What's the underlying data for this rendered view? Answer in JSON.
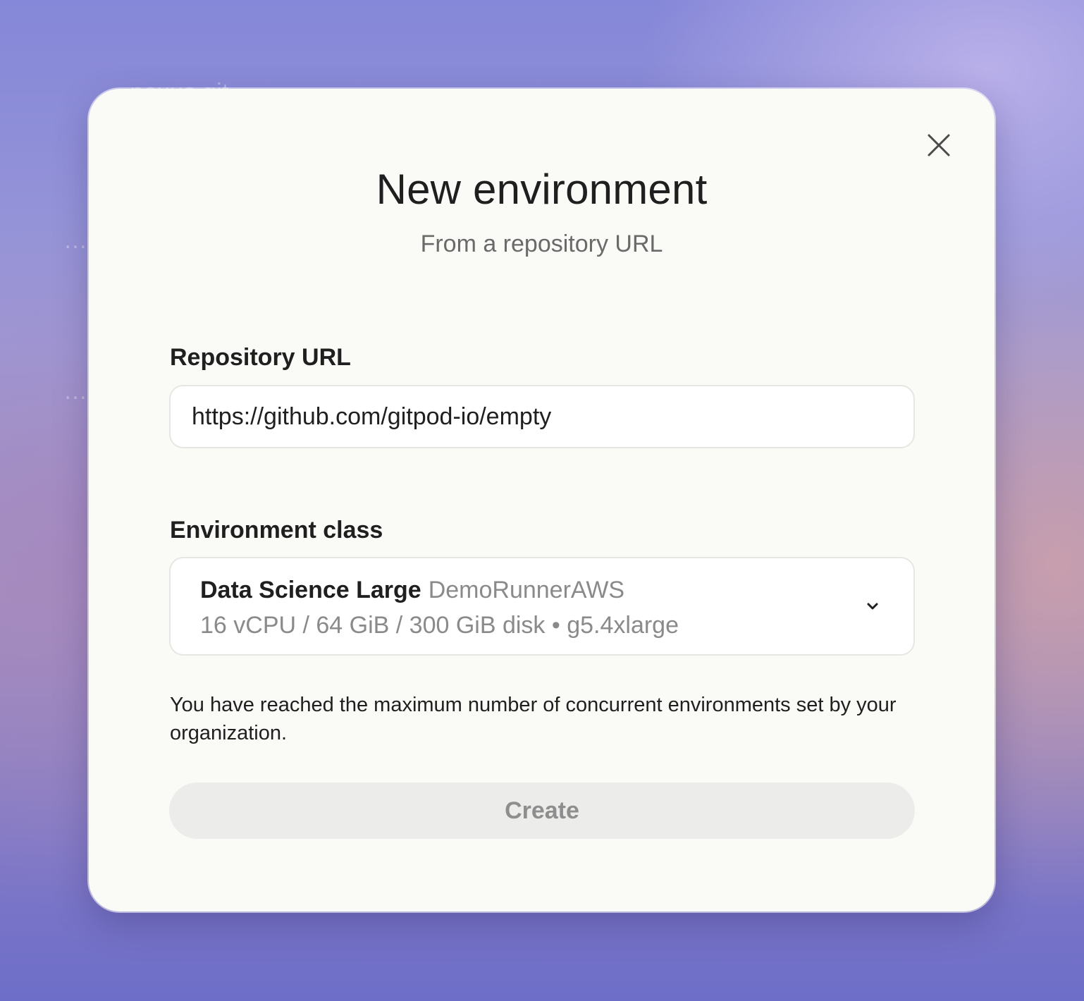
{
  "background": {
    "ghost_texts": [
      "…nexus.git",
      "…eway.git",
      "…ebsite.git"
    ]
  },
  "modal": {
    "close_icon": "close-icon",
    "title": "New environment",
    "subtitle": "From a repository URL",
    "repository": {
      "label": "Repository URL",
      "value": "https://github.com/gitpod-io/empty"
    },
    "environment_class": {
      "label": "Environment class",
      "selected_name": "Data Science Large",
      "selected_runner": "DemoRunnerAWS",
      "selected_specs": "16 vCPU / 64 GiB / 300 GiB disk • g5.4xlarge",
      "chevron_icon": "chevron-down-icon"
    },
    "warning_text": "You have reached the maximum number of concurrent environments set by your organization.",
    "create_label": "Create",
    "create_disabled": true
  },
  "colors": {
    "modal_bg": "#fafaf7",
    "text_primary": "#1f1f1f",
    "text_muted": "#8a8a8a",
    "button_disabled_bg": "#ececea",
    "button_disabled_text": "#8e8e8e"
  }
}
